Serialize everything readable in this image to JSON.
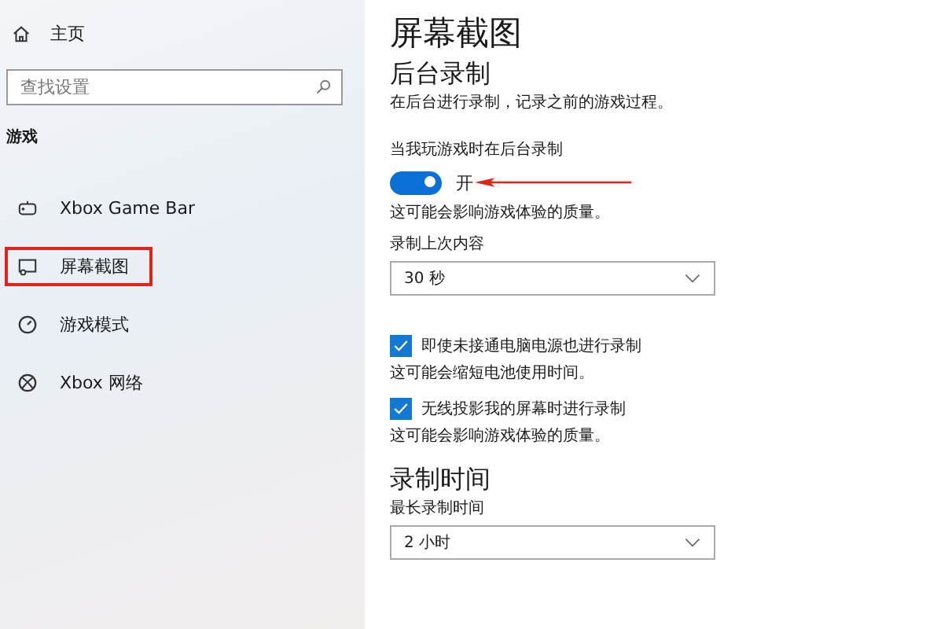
{
  "sidebar": {
    "home": "主页",
    "search": {
      "placeholder": "查找设置"
    },
    "section": "游戏",
    "items": [
      {
        "label": "Xbox Game Bar",
        "selected": false
      },
      {
        "label": "屏幕截图",
        "selected": true
      },
      {
        "label": "游戏模式",
        "selected": false
      },
      {
        "label": "Xbox 网络",
        "selected": false
      }
    ]
  },
  "page": {
    "title": "屏幕截图",
    "sections": [
      {
        "heading": "后台录制",
        "description": "在后台进行录制，记录之前的游戏过程。",
        "controls": [
          {
            "kind": "toggle",
            "label": "当我玩游戏时在后台录制",
            "on": true,
            "state_text": "开",
            "note": "这可能会影响游戏体验的质量。",
            "annotated": true
          },
          {
            "kind": "dropdown",
            "label": "录制上次内容",
            "value": "30 秒"
          },
          {
            "kind": "checkbox",
            "label": "即使未接通电脑电源也进行录制",
            "checked": true,
            "note": "这可能会缩短电池使用时间。"
          },
          {
            "kind": "checkbox",
            "label": "无线投影我的屏幕时进行录制",
            "checked": true,
            "note": "这可能会影响游戏体验的质量。"
          }
        ]
      },
      {
        "heading": "录制时间",
        "controls": [
          {
            "kind": "dropdown",
            "label": "最长录制时间",
            "value": "2 小时"
          }
        ]
      }
    ]
  }
}
